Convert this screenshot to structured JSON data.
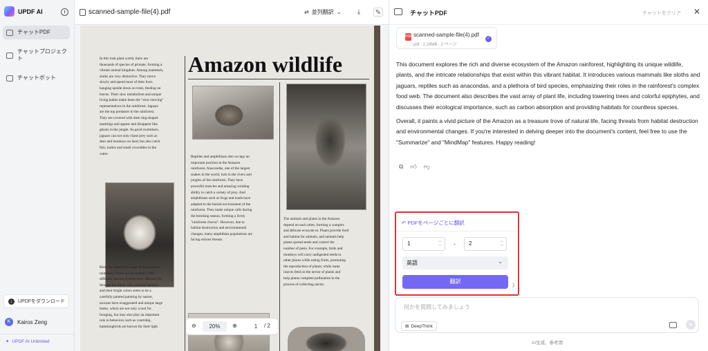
{
  "sidebar": {
    "brand": "UPDF AI",
    "items": [
      {
        "label": "チャットPDF",
        "icon": "chat-pdf-icon"
      },
      {
        "label": "チャットプロジェクト",
        "icon": "folder-icon"
      },
      {
        "label": "チャットボット",
        "icon": "bot-icon"
      }
    ],
    "download_label": "UPDFをダウンロード",
    "user_name": "Kairos Zeng",
    "user_initial": "K",
    "unlimited_label": "UPDF AI Unlimited"
  },
  "document": {
    "file_name": "scanned-sample-file(4).pdf",
    "translate_label": "並列翻訳",
    "headline": "Amazon wildlife",
    "col1_top": "In this lush plant world, there are\nthousands of species of primate, forming a\nvibrant animal kingdom. Among mammals,\nsloths are very distinctive. They move\nslowly and spend most of their lives\nhanging upside down on trees, feeding on\nleaves. Their slow metabolism and unique\nliving habits make them the \"slow-moving\"\nrepresentatives in the rainforest. Jaguars\nare the top predators in the rainforest.\nThey are covered with dark ring-shaped\nmarkings and appear and disappear like\nghosts in the jungle. As good swimmers,\njaguars can not only chase prey such as\ndeer and monkeys on land, but also catch\nfish, turtles and small crocodiles in the\nwater.",
    "col1_bottom": "Birds are a beautiful sight in the Amazon\nrainforest. There are more than 1,000\ndifferent species of birds here. Macaws fly\nthrough the forest with colorful feathers,\nand their bright colors seem to be a\ncarefully painted painting by nature,\ntoucans have exaggerated and unique large\nbeaks, which are not only a tool for\nforaging, but may also play an important\nrole in behaviors such as courtship,\nhummingbirds are known for their light",
    "col2": "Reptiles and amphibians also occupy an\nimportant position in the Amazon\nrainforest. Anacondas, one of the largest\nsnakes in the world, lurk in the rivers and\njungles of the rainforest. They have\npowerful muscles and amazing winding\nability to catch a variety of prey. And\namphibians such as frogs and toads have\nadapted to the humid environment of the\nrainforest. They make unique calls during\nthe breeding season, forming a lively\n\"rainforest chorus\". However, due to\nhabitat destruction and environmental\nchanges, many amphibian populations are\nfacing serious threats.",
    "col3": "The animals and plants in the Amazon\ndepend on each other, forming a complex\nand delicate ecosyste m. Plants provide food\nand habitat for animals, and animals help\nplants spread seeds and control the\nnumber of pests. For example, birds and\nmonkeys will carry undigested seeds to\nother places while eating fruits, promoting\nthe reproduction of plants; while some\ninsects feed on the nectar of plants and\nhelp plants complete pollination in the\nprocess of collecting nectar.",
    "zoom": "20%",
    "page_current": "1",
    "page_total": "/ 2"
  },
  "chat": {
    "title": "チャットPDF",
    "clear_label": "チャットをクリア",
    "file_card_name": "scanned-sample-file(4).pdf",
    "file_card_meta": "pdf · 2.24MB · 2 ページ",
    "summary_p1": "This document explores the rich and diverse ecosystem of the Amazon rainforest, highlighting its unique wildlife, plants, and the intricate relationships that exist within this vibrant habitat. It introduces various mammals like sloths and jaguars, reptiles such as anacondas, and a plethora of bird species, emphasizing their roles in the rainforest's complex food web. The document also describes the vast array of plant life, including towering trees and colorful epiphytes, and discusses their ecological importance, such as carbon absorption and providing habitats for countless species.",
    "summary_p2": "Overall, it paints a vivid picture of the Amazon as a treasure trove of natural life, facing threats from habitat destruction and environmental changes. If you're interested in delving deeper into the document's content, feel free to use the \"Summarize\" and \"MindMap\" features. Happy reading!",
    "translate_panel": {
      "title": "PDFをページごとに翻訳",
      "from_page": "1",
      "to_page": "2",
      "language": "英語",
      "button": "翻訳"
    },
    "input_placeholder": "何かを質問してみましょう",
    "deepthink_label": "DeepThink",
    "footnote": "AI生成、参考用"
  }
}
